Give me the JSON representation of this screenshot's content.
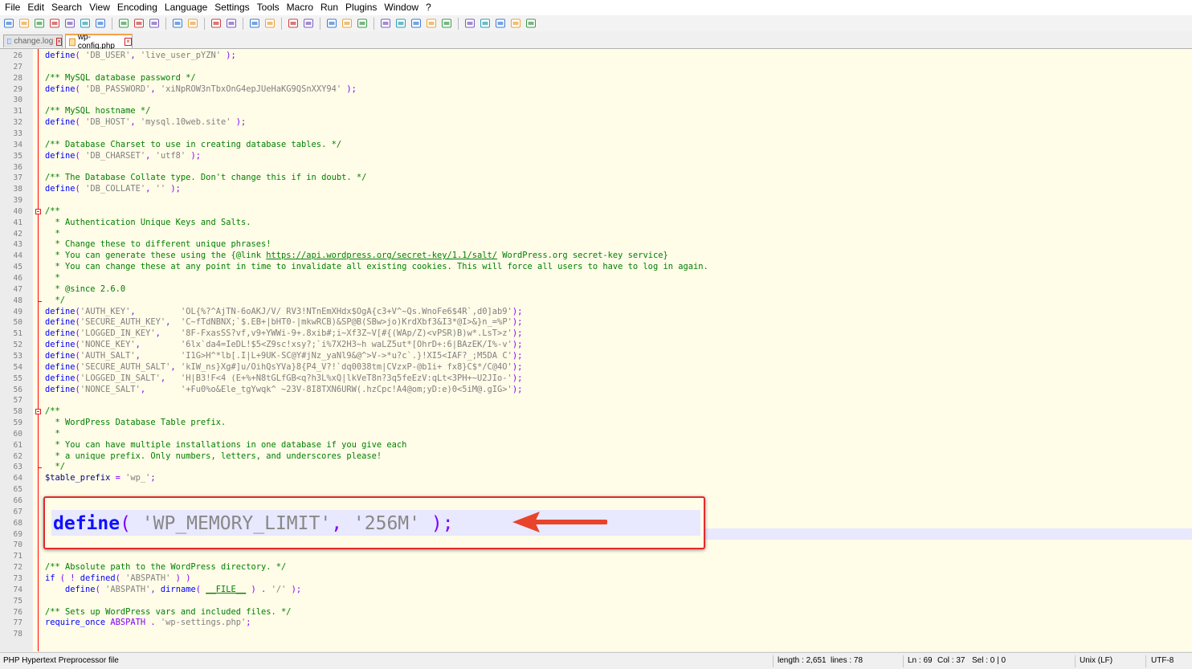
{
  "menu": [
    "File",
    "Edit",
    "Search",
    "View",
    "Encoding",
    "Language",
    "Settings",
    "Tools",
    "Macro",
    "Run",
    "Plugins",
    "Window",
    "?"
  ],
  "toolbar_icons": [
    "new-file-icon",
    "open-file-icon",
    "save-icon",
    "save-all-icon",
    "close-icon",
    "close-all-icon",
    "print-icon",
    "sep",
    "cut-icon",
    "copy-icon",
    "paste-icon",
    "sep",
    "undo-icon",
    "redo-icon",
    "sep",
    "find-icon",
    "replace-icon",
    "sep",
    "zoom-in-icon",
    "zoom-out-icon",
    "sep",
    "sync-vertical-icon",
    "sync-horizontal-icon",
    "sep",
    "word-wrap-icon",
    "show-all-chars-icon",
    "indent-guide-icon",
    "sep",
    "user-language-icon",
    "doc-map-icon",
    "function-list-icon",
    "folder-workspace-icon",
    "monitor-icon",
    "sep",
    "record-macro-icon",
    "stop-record-icon",
    "play-macro-icon",
    "play-multiple-icon",
    "save-macro-icon"
  ],
  "tabs": [
    {
      "label": "change.log",
      "active": false
    },
    {
      "label": "wp-config.php",
      "active": true
    }
  ],
  "editor": {
    "lines": [
      {
        "n": "26",
        "t": [
          [
            "define",
            "kw"
          ],
          [
            "( ",
            "op"
          ],
          [
            "'DB_USER'",
            "str"
          ],
          [
            ", ",
            "op"
          ],
          [
            "'live_user_pYZN'",
            "str"
          ],
          [
            " );",
            "op"
          ]
        ]
      },
      {
        "n": "27",
        "t": []
      },
      {
        "n": "28",
        "t": [
          [
            "/** MySQL database password */",
            "cm"
          ]
        ]
      },
      {
        "n": "29",
        "t": [
          [
            "define",
            "kw"
          ],
          [
            "( ",
            "op"
          ],
          [
            "'DB_PASSWORD'",
            "str"
          ],
          [
            ", ",
            "op"
          ],
          [
            "'xiNpROW3nTbxOnG4epJUeHaKG9QSnXXY94'",
            "str"
          ],
          [
            " );",
            "op"
          ]
        ]
      },
      {
        "n": "30",
        "t": []
      },
      {
        "n": "31",
        "t": [
          [
            "/** MySQL hostname */",
            "cm"
          ]
        ]
      },
      {
        "n": "32",
        "t": [
          [
            "define",
            "kw"
          ],
          [
            "( ",
            "op"
          ],
          [
            "'DB_HOST'",
            "str"
          ],
          [
            ", ",
            "op"
          ],
          [
            "'mysql.10web.site'",
            "str"
          ],
          [
            " );",
            "op"
          ]
        ]
      },
      {
        "n": "33",
        "t": []
      },
      {
        "n": "34",
        "t": [
          [
            "/** Database Charset to use in creating database tables. */",
            "cm"
          ]
        ]
      },
      {
        "n": "35",
        "t": [
          [
            "define",
            "kw"
          ],
          [
            "( ",
            "op"
          ],
          [
            "'DB_CHARSET'",
            "str"
          ],
          [
            ", ",
            "op"
          ],
          [
            "'utf8'",
            "str"
          ],
          [
            " );",
            "op"
          ]
        ]
      },
      {
        "n": "36",
        "t": []
      },
      {
        "n": "37",
        "t": [
          [
            "/** The Database Collate type. Don't change this if in doubt. */",
            "cm"
          ]
        ]
      },
      {
        "n": "38",
        "t": [
          [
            "define",
            "kw"
          ],
          [
            "( ",
            "op"
          ],
          [
            "'DB_COLLATE'",
            "str"
          ],
          [
            ", ",
            "op"
          ],
          [
            "''",
            "str"
          ],
          [
            " );",
            "op"
          ]
        ]
      },
      {
        "n": "39",
        "t": []
      },
      {
        "n": "40",
        "t": [
          [
            "/**",
            "cm"
          ]
        ]
      },
      {
        "n": "41",
        "t": [
          [
            "  * Authentication Unique Keys and Salts.",
            "cm"
          ]
        ]
      },
      {
        "n": "42",
        "t": [
          [
            "  *",
            "cm"
          ]
        ]
      },
      {
        "n": "43",
        "t": [
          [
            "  * Change these to different unique phrases!",
            "cm"
          ]
        ]
      },
      {
        "n": "44",
        "t": [
          [
            "  * You can generate these using the {@link ",
            "cm"
          ],
          [
            "https://api.wordpress.org/secret-key/1.1/salt/",
            "lnk"
          ],
          [
            " WordPress.org secret-key service}",
            "cm"
          ]
        ]
      },
      {
        "n": "45",
        "t": [
          [
            "  * You can change these at any point in time to invalidate all existing cookies. This will force all users to have to log in again.",
            "cm"
          ]
        ]
      },
      {
        "n": "46",
        "t": [
          [
            "  *",
            "cm"
          ]
        ]
      },
      {
        "n": "47",
        "t": [
          [
            "  * @since 2.6.0",
            "cm"
          ]
        ]
      },
      {
        "n": "48",
        "t": [
          [
            "  */",
            "cm"
          ]
        ]
      },
      {
        "n": "49",
        "t": [
          [
            "define",
            "kw"
          ],
          [
            "(",
            "op"
          ],
          [
            "'AUTH_KEY'",
            "str"
          ],
          [
            ",         ",
            "op"
          ],
          [
            "'OL{%?^AjTN-6oAKJ/V/ RV3!NTnEmXHdx$OgA{c3+V^~Qs.WnoFe6$4R`,d0]ab9'",
            "str"
          ],
          [
            ");",
            "op"
          ]
        ]
      },
      {
        "n": "50",
        "t": [
          [
            "define",
            "kw"
          ],
          [
            "(",
            "op"
          ],
          [
            "'SECURE_AUTH_KEY'",
            "str"
          ],
          [
            ",  ",
            "op"
          ],
          [
            "'C~fTdNBNX;`$.EB+|bHT0-|mkwRCB)&SP@B(SBw>jo)KrdXbf3&I3*@I>&}n_=%P'",
            "str"
          ],
          [
            ");",
            "op"
          ]
        ]
      },
      {
        "n": "51",
        "t": [
          [
            "define",
            "kw"
          ],
          [
            "(",
            "op"
          ],
          [
            "'LOGGED_IN_KEY'",
            "str"
          ],
          [
            ",    ",
            "op"
          ],
          [
            "'8F-FxasSS?vf,v9+YWWi-9+.8xib#;i~Xf3Z~V[#{(WAp/Z)<vPSR)B)w*.LsT>z'",
            "str"
          ],
          [
            ");",
            "op"
          ]
        ]
      },
      {
        "n": "52",
        "t": [
          [
            "define",
            "kw"
          ],
          [
            "(",
            "op"
          ],
          [
            "'NONCE_KEY'",
            "str"
          ],
          [
            ",        ",
            "op"
          ],
          [
            "'6lx`da4=IeDL!$5<Z9sc!xsy?;`i%7X2H3~h waLZ5ut*[OhrD+:6|BAzEK/I%-v'",
            "str"
          ],
          [
            ");",
            "op"
          ]
        ]
      },
      {
        "n": "53",
        "t": [
          [
            "define",
            "kw"
          ],
          [
            "(",
            "op"
          ],
          [
            "'AUTH_SALT'",
            "str"
          ],
          [
            ",        ",
            "op"
          ],
          [
            "'I1G>H^*lb[.I|L+9UK-SC@Y#jNz_yaNl9&@^>V->*u?c`.}!XI5<IAF?_;M5DA C'",
            "str"
          ],
          [
            ");",
            "op"
          ]
        ]
      },
      {
        "n": "54",
        "t": [
          [
            "define",
            "kw"
          ],
          [
            "(",
            "op"
          ],
          [
            "'SECURE_AUTH_SALT'",
            "str"
          ],
          [
            ", ",
            "op"
          ],
          [
            "'kIW_ns}Xg#]u/OihQsYVa}8{P4_V?!`dq0038tm|CVzxP-@b1i+ fx8}C$*/C@4O'",
            "str"
          ],
          [
            ");",
            "op"
          ]
        ]
      },
      {
        "n": "55",
        "t": [
          [
            "define",
            "kw"
          ],
          [
            "(",
            "op"
          ],
          [
            "'LOGGED_IN_SALT'",
            "str"
          ],
          [
            ",   ",
            "op"
          ],
          [
            "'H|B3!F<4 (E+%+N8tGLfGB<q?h3L%xQ|lkVeT8n?3q5feEzV:qLt<3PH+~U2JIo-'",
            "str"
          ],
          [
            ");",
            "op"
          ]
        ]
      },
      {
        "n": "56",
        "t": [
          [
            "define",
            "kw"
          ],
          [
            "(",
            "op"
          ],
          [
            "'NONCE_SALT'",
            "str"
          ],
          [
            ",       ",
            "op"
          ],
          [
            "'+Fu0%o&Ele_tgYwqk^ ~23V-8I8TXN6URW(.hzCpc!A4@om;yD:e)0<5iM@.gIG>'",
            "str"
          ],
          [
            ");",
            "op"
          ]
        ]
      },
      {
        "n": "57",
        "t": []
      },
      {
        "n": "58",
        "t": [
          [
            "/**",
            "cm"
          ]
        ]
      },
      {
        "n": "59",
        "t": [
          [
            "  * WordPress Database Table prefix.",
            "cm"
          ]
        ]
      },
      {
        "n": "60",
        "t": [
          [
            "  *",
            "cm"
          ]
        ]
      },
      {
        "n": "61",
        "t": [
          [
            "  * You can have multiple installations in one database if you give each",
            "cm"
          ]
        ]
      },
      {
        "n": "62",
        "t": [
          [
            "  * a unique prefix. Only numbers, letters, and underscores please!",
            "cm"
          ]
        ]
      },
      {
        "n": "63",
        "t": [
          [
            "  */",
            "cm"
          ]
        ]
      },
      {
        "n": "64",
        "t": [
          [
            "$table_prefix",
            "var"
          ],
          [
            " = ",
            "op"
          ],
          [
            "'wp_'",
            "str"
          ],
          [
            ";",
            "op"
          ]
        ]
      },
      {
        "n": "65",
        "t": []
      },
      {
        "n": "66",
        "t": []
      },
      {
        "n": "67",
        "t": []
      },
      {
        "n": "68",
        "t": []
      },
      {
        "n": "69",
        "t": []
      },
      {
        "n": "70",
        "t": []
      },
      {
        "n": "71",
        "t": []
      },
      {
        "n": "72",
        "t": [
          [
            "/** Absolute path to the WordPress directory. */",
            "cm"
          ]
        ]
      },
      {
        "n": "73",
        "t": [
          [
            "if",
            "kw"
          ],
          [
            " ( ! ",
            "op"
          ],
          [
            "defined",
            "kw"
          ],
          [
            "( ",
            "op"
          ],
          [
            "'ABSPATH'",
            "str"
          ],
          [
            " ) )",
            "op"
          ]
        ]
      },
      {
        "n": "74",
        "t": [
          [
            "    ",
            "op"
          ],
          [
            "define",
            "kw"
          ],
          [
            "( ",
            "op"
          ],
          [
            "'ABSPATH'",
            "str"
          ],
          [
            ", ",
            "op"
          ],
          [
            "dirname",
            "kw"
          ],
          [
            "( ",
            "op"
          ],
          [
            "__FILE__",
            "lnk"
          ],
          [
            " ) . ",
            "op"
          ],
          [
            "'/'",
            "str"
          ],
          [
            " );",
            "op"
          ]
        ]
      },
      {
        "n": "75",
        "t": []
      },
      {
        "n": "76",
        "t": [
          [
            "/** Sets up WordPress vars and included files. */",
            "cm"
          ]
        ]
      },
      {
        "n": "77",
        "t": [
          [
            "require_once",
            "kw"
          ],
          [
            " ABSPATH . ",
            "op"
          ],
          [
            "'wp-settings.php'",
            "str"
          ],
          [
            ";",
            "op"
          ]
        ]
      },
      {
        "n": "78",
        "t": []
      }
    ],
    "callout": {
      "keyword": "define",
      "open": "( ",
      "arg1": "'WP_MEMORY_LIMIT'",
      "comma": ", ",
      "arg2": "'256M'",
      "close": " );"
    }
  },
  "status": {
    "file_type": "PHP Hypertext Preprocessor file",
    "length": "length : 2,651",
    "lines": "lines : 78",
    "ln": "Ln : 69",
    "col": "Col : 37",
    "sel": "Sel : 0 | 0",
    "eol": "Unix (LF)",
    "encoding": "UTF-8"
  },
  "colors": {
    "fold_line": "#ff0000",
    "callout_border": "#e22a2a",
    "arrow": "#e8432b",
    "tab_accent": "#f6a24b"
  }
}
